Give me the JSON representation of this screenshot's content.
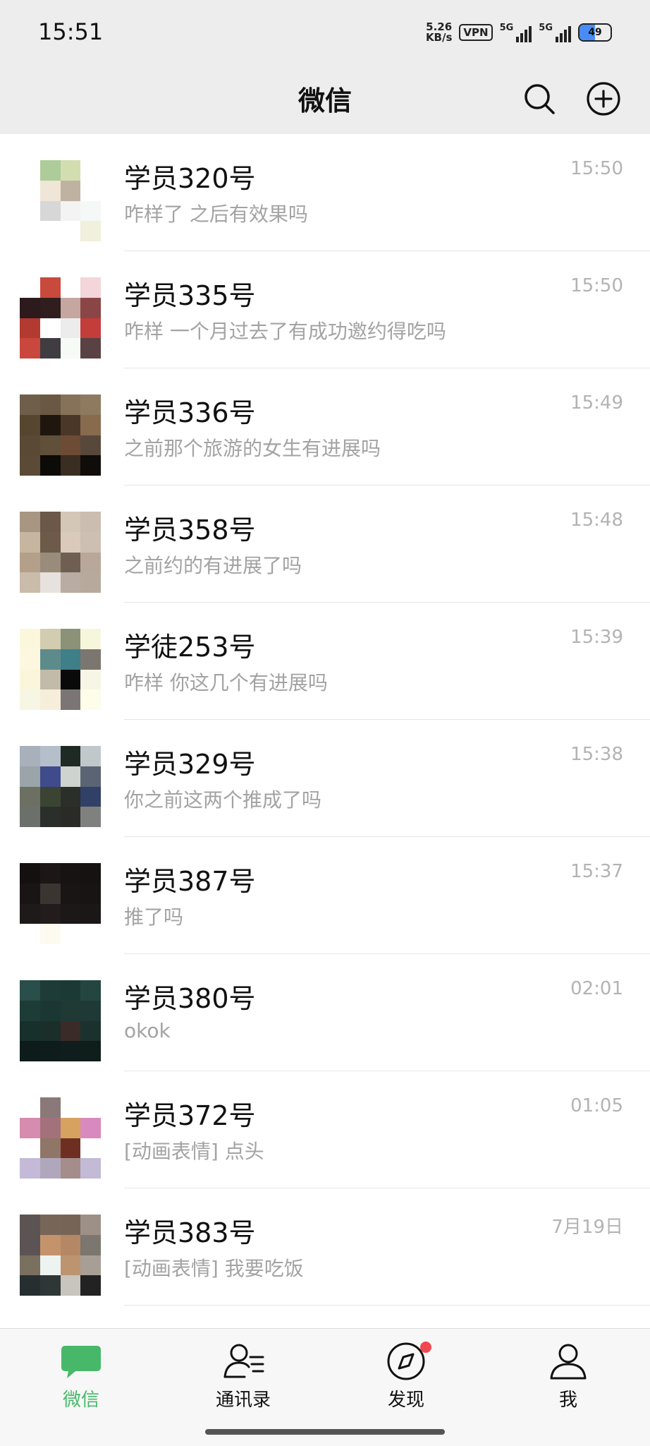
{
  "status_bar": {
    "time": "15:51",
    "speed_value": "5.26",
    "speed_unit": "KB/s",
    "vpn": "VPN",
    "signal_1": "5G",
    "signal_2": "5G",
    "battery": "49",
    "battery_level": 0.49
  },
  "header": {
    "title": "微信",
    "search_icon": "search-icon",
    "add_icon": "plus-circle-icon"
  },
  "chats": [
    {
      "name": "学员320号",
      "message": "咋样了 之后有效果吗",
      "time": "15:50",
      "avatar_colors": [
        "#ffffff",
        "#aecb9a",
        "#d3deb0",
        "#ffffff",
        "#ffffff",
        "#f0e6d7",
        "#bfb2a0",
        "#ffffff",
        "#ffffff",
        "#d7d7d7",
        "#f3f3f3",
        "#f4f8f7",
        "#ffffff",
        "#ffffff",
        "#ffffff",
        "#f1f0dc"
      ]
    },
    {
      "name": "学员335号",
      "message": "咋样 一个月过去了有成功邀约得吃吗",
      "time": "15:50",
      "avatar_colors": [
        "#ffffff",
        "#c84a3d",
        "#ffffff",
        "#f3d5da",
        "#2c1a1d",
        "#301d1e",
        "#c6a6a0",
        "#8a4646",
        "#b23a31",
        "#ffffff",
        "#ececec",
        "#c33d3b",
        "#c9473d",
        "#3f3c42",
        "#f6fbf6",
        "#5a4143"
      ]
    },
    {
      "name": "学员336号",
      "message": "之前那个旅游的女生有进展吗",
      "time": "15:49",
      "avatar_colors": [
        "#6f5f4a",
        "#6b5844",
        "#857259",
        "#8e7a5f",
        "#56452f",
        "#1f170e",
        "#4a3727",
        "#876b4c",
        "#5a4a35",
        "#60503a",
        "#6e4b35",
        "#58483b",
        "#5b4a35",
        "#0d0b08",
        "#3a2d22",
        "#0f0c09"
      ]
    },
    {
      "name": "学员358号",
      "message": "之前约的有进展了吗",
      "time": "15:48",
      "avatar_colors": [
        "#a89682",
        "#6b5848",
        "#d5c7b7",
        "#cbbdaf",
        "#c6b6a0",
        "#6d5a48",
        "#d9cabb",
        "#cdbfb1",
        "#b4a08a",
        "#9a8c7a",
        "#6e5f52",
        "#b8a89a",
        "#cbbbaa",
        "#e7e2dd",
        "#b9aca2",
        "#b7aa9c"
      ]
    },
    {
      "name": "学徒253号",
      "message": "咋样 你这几个有进展吗",
      "time": "15:39",
      "avatar_colors": [
        "#fbf7dd",
        "#d2ccb1",
        "#8a9277",
        "#f5f6dc",
        "#fdf7e0",
        "#5d8b8c",
        "#3f7f8a",
        "#7c7670",
        "#fbf5dc",
        "#c2bbaa",
        "#0a0a0a",
        "#f7f6e6",
        "#f7f5e4",
        "#f6eeda",
        "#7b7675",
        "#fdfde9"
      ]
    },
    {
      "name": "学员329号",
      "message": "你之前这两个推成了吗",
      "time": "15:38",
      "avatar_colors": [
        "#a7b0bb",
        "#b4bfca",
        "#1f2a24",
        "#c0c8cc",
        "#9ba5a9",
        "#3f4b8b",
        "#cfd3cf",
        "#5a6474",
        "#6c7063",
        "#3b4333",
        "#2b2f2a",
        "#314066",
        "#6b706b",
        "#2b2f2b",
        "#2a2b26",
        "#7f817f"
      ]
    },
    {
      "name": "学员387号",
      "message": "推了吗",
      "time": "15:37",
      "avatar_colors": [
        "#141010",
        "#1c1616",
        "#171313",
        "#161212",
        "#1a1515",
        "#3a3530",
        "#191515",
        "#181414",
        "#1e1a1a",
        "#221d1c",
        "#1c1818",
        "#1b1717",
        "#ffffff",
        "#fdfaf0",
        "#ffffff",
        "#ffffff"
      ]
    },
    {
      "name": "学员380号",
      "message": "okok",
      "time": "02:01",
      "avatar_colors": [
        "#2a4e49",
        "#1e3c37",
        "#1c3a35",
        "#244640",
        "#1d3b37",
        "#1b3733",
        "#1f3935",
        "#1f3a36",
        "#17302c",
        "#1b2e2a",
        "#3b2b28",
        "#1b312d",
        "#0d1c1a",
        "#0e1d1b",
        "#0f1e1c",
        "#0f1d1b"
      ]
    },
    {
      "name": "学员372号",
      "message": "[动画表情] 点头",
      "time": "01:05",
      "avatar_colors": [
        "#ffffff",
        "#8a7978",
        "#ffffff",
        "#ffffff",
        "#d58cae",
        "#a3717c",
        "#d6a25f",
        "#d889be",
        "#ffffff",
        "#907666",
        "#6e2f22",
        "#ffffff",
        "#c4bad7",
        "#b1a7bd",
        "#a48d8a",
        "#c3bad6"
      ]
    },
    {
      "name": "学员383号",
      "message": "[动画表情] 我要吃饭",
      "time": "7月19日",
      "avatar_colors": [
        "#5b5453",
        "#776657",
        "#766556",
        "#9c9087",
        "#5c5454",
        "#c5936b",
        "#b68765",
        "#7b766f",
        "#7a7060",
        "#edf3f0",
        "#bc946f",
        "#a79e95",
        "#262e30",
        "#2f3636",
        "#c8c4be",
        "#222222"
      ]
    }
  ],
  "tabs": [
    {
      "label": "微信",
      "icon": "chat-bubble-icon",
      "active": true
    },
    {
      "label": "通讯录",
      "icon": "contacts-icon",
      "active": false
    },
    {
      "label": "发现",
      "icon": "compass-icon",
      "active": false
    },
    {
      "label": "我",
      "icon": "person-icon",
      "active": false
    }
  ]
}
